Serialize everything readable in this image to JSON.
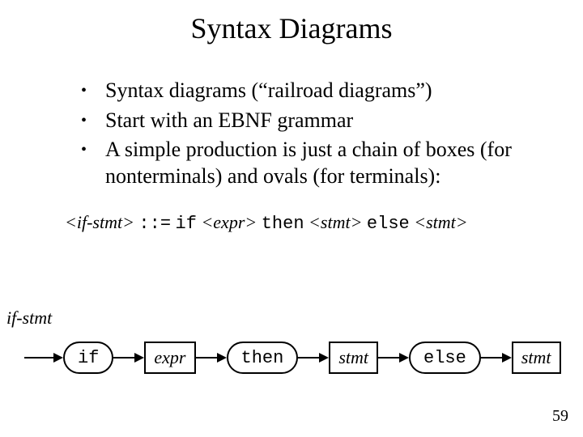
{
  "title": "Syntax Diagrams",
  "bullets": [
    "Syntax diagrams (“railroad diagrams”)",
    "Start with an EBNF grammar",
    "A simple production is just a chain of boxes (for nonterminals) and ovals (for terminals):"
  ],
  "grammar": {
    "lhs": "<if-stmt>",
    "op": "::=",
    "rhs": [
      {
        "kind": "terminal",
        "text": "if"
      },
      {
        "kind": "nonterminal",
        "text": "<expr>"
      },
      {
        "kind": "terminal",
        "text": "then"
      },
      {
        "kind": "nonterminal",
        "text": "<stmt>"
      },
      {
        "kind": "terminal",
        "text": "else"
      },
      {
        "kind": "nonterminal",
        "text": "<stmt>"
      }
    ]
  },
  "diagram": {
    "label": "if-stmt",
    "nodes": [
      {
        "kind": "terminal",
        "text": "if"
      },
      {
        "kind": "nonterminal",
        "text": "expr"
      },
      {
        "kind": "terminal",
        "text": "then"
      },
      {
        "kind": "nonterminal",
        "text": "stmt"
      },
      {
        "kind": "terminal",
        "text": "else"
      },
      {
        "kind": "nonterminal",
        "text": "stmt"
      }
    ]
  },
  "page_number": "59"
}
